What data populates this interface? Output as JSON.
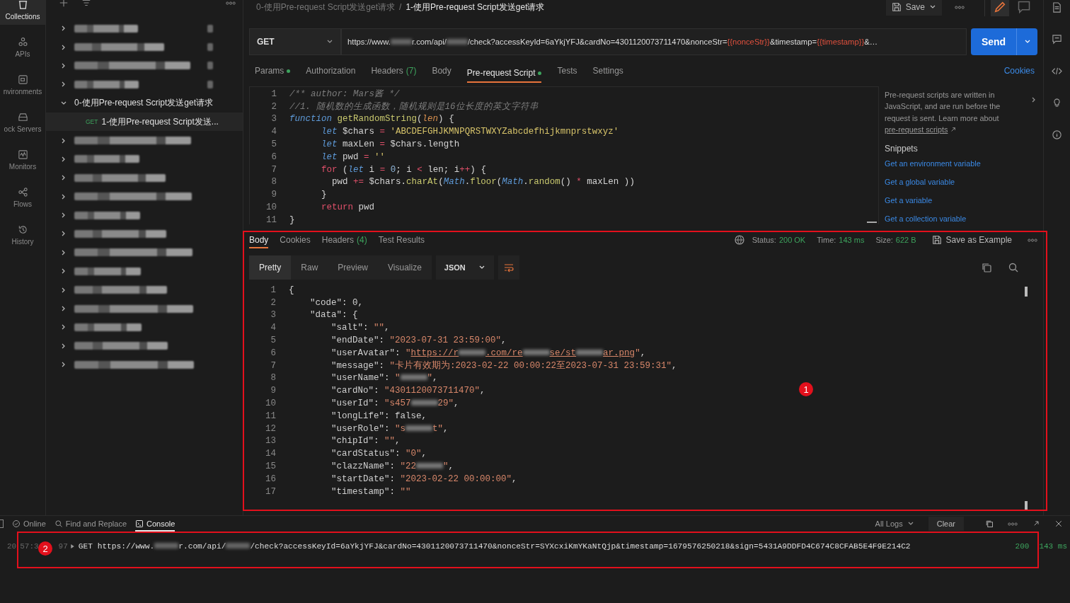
{
  "nav": [
    {
      "label": "Collections",
      "selected": true
    },
    {
      "label": "APIs",
      "selected": false
    },
    {
      "label": "nvironments",
      "selected": false
    },
    {
      "label": "ock Servers",
      "selected": false
    },
    {
      "label": "Monitors",
      "selected": false
    },
    {
      "label": "Flows",
      "selected": false
    },
    {
      "label": "History",
      "selected": false
    }
  ],
  "tree": [
    {
      "kind": "blurred",
      "expanded": false
    },
    {
      "kind": "blurred",
      "expanded": false
    },
    {
      "kind": "blurred",
      "expanded": false
    },
    {
      "kind": "blurred",
      "expanded": false
    },
    {
      "kind": "folder",
      "label": "0-使用Pre-request Script发送get请求",
      "expanded": true,
      "children": [
        {
          "method": "GET",
          "label": "1-使用Pre-request Script发送...",
          "selected": true
        }
      ]
    },
    {
      "kind": "blurred",
      "expanded": false
    },
    {
      "kind": "blurred",
      "expanded": false
    },
    {
      "kind": "blurred",
      "expanded": false
    },
    {
      "kind": "blurred",
      "expanded": false
    },
    {
      "kind": "blurred",
      "expanded": false
    },
    {
      "kind": "blurred",
      "expanded": false
    },
    {
      "kind": "blurred",
      "expanded": false
    },
    {
      "kind": "blurred",
      "expanded": false
    },
    {
      "kind": "blurred",
      "expanded": false
    },
    {
      "kind": "blurred",
      "expanded": false
    },
    {
      "kind": "blurred",
      "expanded": false
    },
    {
      "kind": "blurred",
      "expanded": false
    },
    {
      "kind": "blurred",
      "expanded": false
    }
  ],
  "breadcrumb": {
    "parent": "0-使用Pre-request Script发送get请求",
    "separator": "/",
    "current": "1-使用Pre-request Script发送get请求"
  },
  "save_button": "Save",
  "request": {
    "method": "GET",
    "url": [
      {
        "kind": "text",
        "text": "https://www."
      },
      {
        "kind": "blur"
      },
      {
        "kind": "text",
        "text": "r.com/api/"
      },
      {
        "kind": "blur"
      },
      {
        "kind": "text",
        "text": "/check?accessKeyId=6aYkjYFJ&cardNo=4301120073711470&nonceStr="
      },
      {
        "kind": "var",
        "text": "{{nonceStr}}"
      },
      {
        "kind": "text",
        "text": "&timestamp="
      },
      {
        "kind": "var",
        "text": "{{timestamp}}"
      },
      {
        "kind": "text",
        "text": "&…"
      }
    ],
    "send": "Send"
  },
  "request_tabs": [
    {
      "label": "Params",
      "indicator": true,
      "selected": false
    },
    {
      "label": "Authorization",
      "indicator": false,
      "selected": false
    },
    {
      "label": "Headers",
      "count": "(7)",
      "indicator": false,
      "selected": false
    },
    {
      "label": "Body",
      "indicator": false,
      "selected": false
    },
    {
      "label": "Pre-request Script",
      "indicator": true,
      "selected": true
    },
    {
      "label": "Tests",
      "indicator": false,
      "selected": false
    },
    {
      "label": "Settings",
      "indicator": false,
      "selected": false
    }
  ],
  "cookies_link": "Cookies",
  "script_lines": [
    {
      "n": "1",
      "code": "/** author: Mars酱 */"
    },
    {
      "n": "2",
      "code": "//1. 随机数的生成函数，随机规则是16位长度的英文字符串"
    },
    {
      "n": "3",
      "code": "function getRandomString(len) {"
    },
    {
      "n": "4",
      "code": "      let $chars = 'ABCDEFGHJKMNPQRSTWXYZabcdefhijkmnprstwxyz'"
    },
    {
      "n": "5",
      "code": "      let maxLen = $chars.length"
    },
    {
      "n": "6",
      "code": "      let pwd = ''"
    },
    {
      "n": "7",
      "code": "      for (let i = 0; i < len; i++) {"
    },
    {
      "n": "8",
      "code": "        pwd += $chars.charAt(Math.floor(Math.random() * maxLen ))"
    },
    {
      "n": "9",
      "code": "      }"
    },
    {
      "n": "10",
      "code": "      return pwd"
    },
    {
      "n": "11",
      "code": "}"
    }
  ],
  "help": {
    "text": "Pre-request scripts are written in JavaScript, and are run before the request is sent. Learn more about",
    "link": "pre-request scripts",
    "snippets_title": "Snippets",
    "snippets": [
      "Get an environment variable",
      "Get a global variable",
      "Get a variable",
      "Get a collection variable"
    ]
  },
  "response_tabs": [
    {
      "label": "Body",
      "selected": true
    },
    {
      "label": "Cookies",
      "selected": false
    },
    {
      "label": "Headers",
      "count": "(4)",
      "selected": false
    },
    {
      "label": "Test Results",
      "selected": false
    }
  ],
  "status": {
    "status_label": "Status:",
    "status": "200 OK",
    "time_label": "Time:",
    "time": "143 ms",
    "size_label": "Size:",
    "size": "622 B"
  },
  "save_example": "Save as Example",
  "view_tabs": [
    {
      "label": "Pretty",
      "selected": true
    },
    {
      "label": "Raw",
      "selected": false
    },
    {
      "label": "Preview",
      "selected": false
    },
    {
      "label": "Visualize",
      "selected": false
    }
  ],
  "format": "JSON",
  "body_lines": [
    {
      "n": "1",
      "parts": [
        "{"
      ]
    },
    {
      "n": "2",
      "parts": [
        "    \"code\": 0,"
      ]
    },
    {
      "n": "3",
      "parts": [
        "    \"data\": {"
      ]
    },
    {
      "n": "4",
      "parts": [
        "        \"salt\": \"\","
      ]
    },
    {
      "n": "5",
      "parts": [
        "        \"endDate\": \"2023-07-31 23:59:00\","
      ]
    },
    {
      "n": "6",
      "parts": [
        "        \"userAvatar\": \"https://r",
        ".com/re",
        "se/st",
        "ar.png\","
      ]
    },
    {
      "n": "7",
      "parts": [
        "        \"message\": \"卡片有效期为:2023-02-22 00:00:22至2023-07-31 23:59:31\","
      ]
    },
    {
      "n": "8",
      "parts": [
        "        \"userName\": \"",
        "\","
      ]
    },
    {
      "n": "9",
      "parts": [
        "        \"cardNo\": \"4301120073711470\","
      ]
    },
    {
      "n": "10",
      "parts": [
        "        \"userId\": \"s457",
        "29\","
      ]
    },
    {
      "n": "11",
      "parts": [
        "        \"longLife\": false,"
      ]
    },
    {
      "n": "12",
      "parts": [
        "        \"userRole\": \"s",
        "t\","
      ]
    },
    {
      "n": "13",
      "parts": [
        "        \"chipId\": \"\","
      ]
    },
    {
      "n": "14",
      "parts": [
        "        \"cardStatus\": \"0\","
      ]
    },
    {
      "n": "15",
      "parts": [
        "        \"clazzName\": \"22",
        "\","
      ]
    },
    {
      "n": "16",
      "parts": [
        "        \"startDate\": \"2023-02-22 00:00:00\","
      ]
    },
    {
      "n": "17",
      "parts": [
        "        \"timestamp\": \"\""
      ]
    }
  ],
  "status_bar": {
    "items": [
      {
        "label": "Online",
        "selected": false
      },
      {
        "label": "Find and Replace",
        "selected": false
      },
      {
        "label": "Console",
        "selected": true
      }
    ],
    "logs_filter": "All Logs",
    "clear": "Clear"
  },
  "console": [
    {
      "time_start": "20",
      "time_mid": "57:3",
      "time_end": "97",
      "method": "GET",
      "url": [
        {
          "kind": "text",
          "text": "https://www."
        },
        {
          "kind": "blur"
        },
        {
          "kind": "text",
          "text": "r.com/api/"
        },
        {
          "kind": "blur"
        },
        {
          "kind": "text",
          "text": "/check?accessKeyId=6aYkjYFJ&cardNo=4301120073711470&nonceStr=SYXcxiKmYKaNtQjp&timestamp=1679576250218&sign=5431A9DDFD4C674C8CFAB5E4F9E214C2"
        }
      ],
      "status": "200",
      "time": "143 ms"
    }
  ],
  "annotations": [
    {
      "label": "1"
    },
    {
      "label": "2"
    }
  ]
}
